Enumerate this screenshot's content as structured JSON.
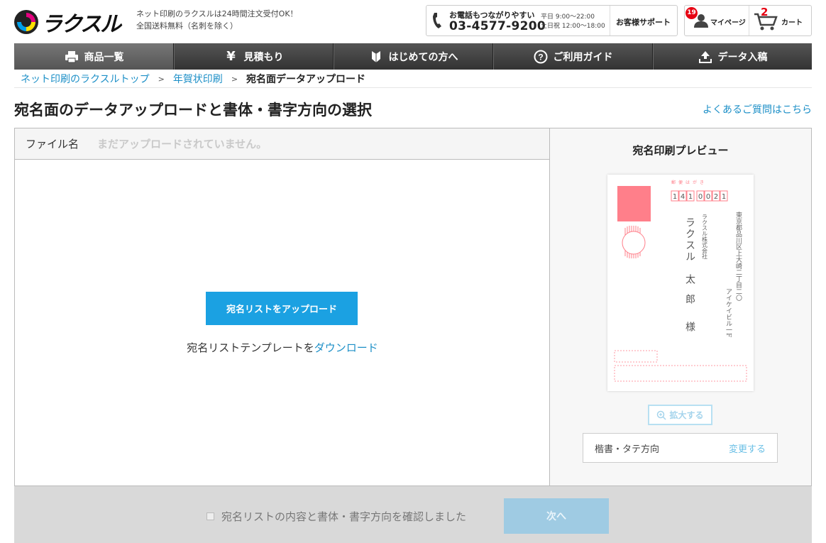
{
  "header": {
    "logo_text": "ラクスル",
    "tagline_1": "ネット印刷のラクスルは24時間注文受付OK！",
    "tagline_2": "全国送料無料（名刺を除く）",
    "phone_caption": "お電話もつながりやすい",
    "phone_number": "03-4577-9200",
    "hours_weekday": "平日 9:00～22:00",
    "hours_weekend": "土日祝 12:00～18:00",
    "support_label": "お客様サポート",
    "mypage_badge": "19",
    "mypage_label": "マイページ",
    "cart_count": "2",
    "cart_label": "カート"
  },
  "nav": {
    "items": [
      {
        "label": "商品一覧",
        "icon": "printer-icon"
      },
      {
        "label": "見積もり",
        "icon": "yen-icon"
      },
      {
        "label": "はじめての方へ",
        "icon": "beginner-mark-icon"
      },
      {
        "label": "ご利用ガイド",
        "icon": "question-circle-icon"
      },
      {
        "label": "データ入稿",
        "icon": "upload-icon"
      }
    ]
  },
  "breadcrumb": {
    "items": [
      "ネット印刷のラクスルトップ",
      "年賀状印刷"
    ],
    "separator": ">",
    "current": "宛名面データアップロード"
  },
  "page": {
    "title": "宛名面のデータアップロードと書体・書字方向の選択",
    "faq_link": "よくあるご質問はこちら"
  },
  "upload": {
    "file_label": "ファイル名",
    "file_status": "まだアップロードされていません。",
    "upload_button": "宛名リストをアップロード",
    "template_prefix": "宛名リストテンプレートを",
    "template_link": "ダウンロード"
  },
  "preview": {
    "title": "宛名印刷プレビュー",
    "postcard_header": "郵便はがき",
    "postal_code": [
      "1",
      "4",
      "1",
      "0",
      "0",
      "2",
      "1"
    ],
    "address_line_1": "東京都品川区上大崎二丁目二〇",
    "address_line_2": "アイケイビル一F",
    "company": "ラクスル株式会社",
    "surname": "ラクスル",
    "given_name": "太郎",
    "honorific": "様",
    "zoom_button": "拡大する",
    "style_label": "楷書・タテ方向",
    "style_change": "変更する"
  },
  "footer": {
    "confirm_label": "宛名リストの内容と書体・書字方向を確認しました",
    "confirm_checked": false,
    "next_button": "次へ"
  },
  "colors": {
    "accent": "#1ba1e2",
    "link": "#1c8fc7",
    "badge": "#e60012",
    "stamp": "#ff7f8a"
  }
}
